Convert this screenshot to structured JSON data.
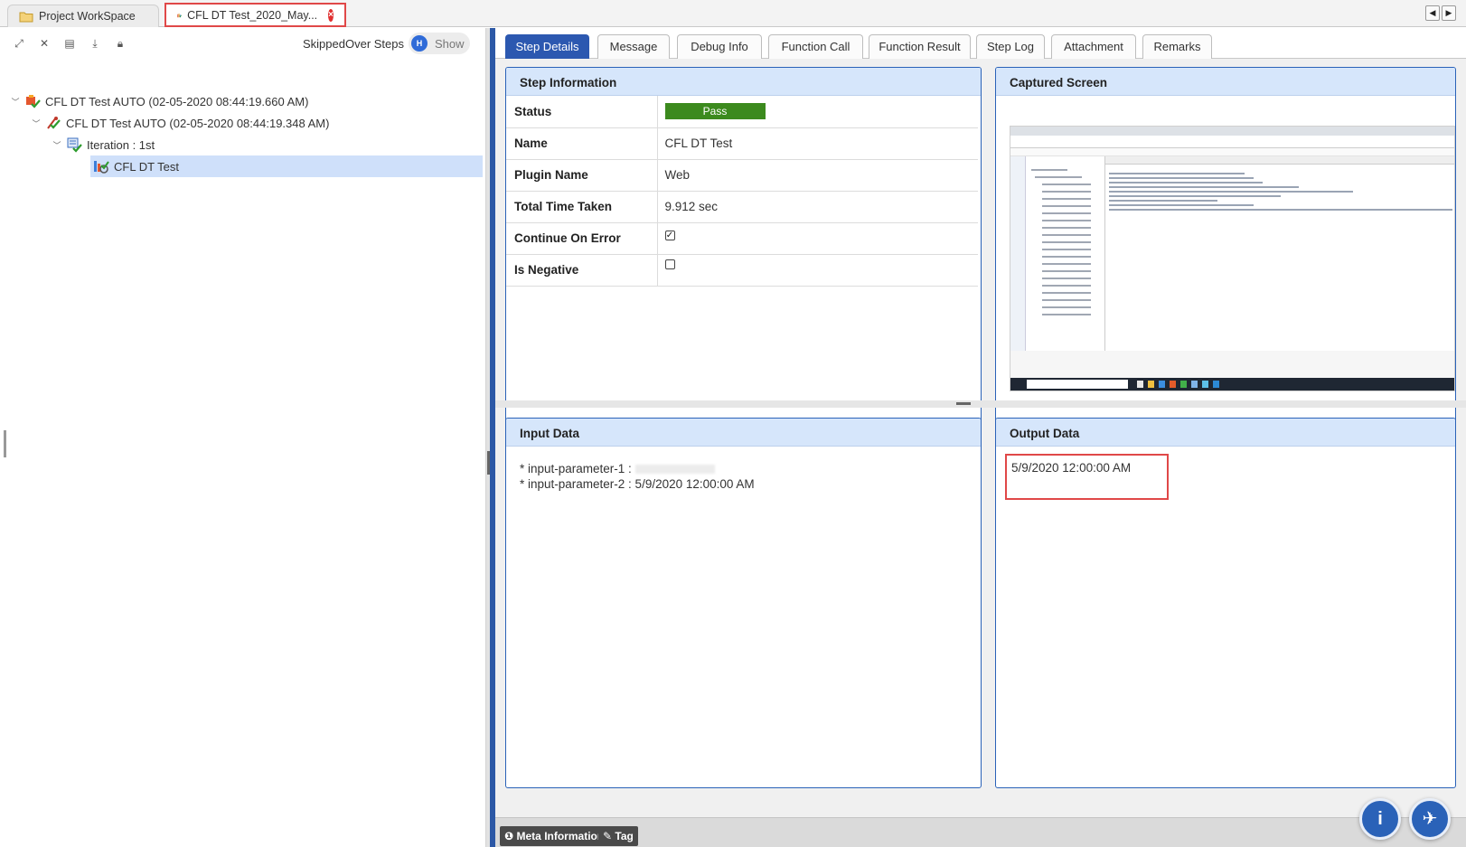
{
  "workspace_tabs": [
    {
      "label": "Project WorkSpace",
      "icon": "folder-icon"
    },
    {
      "label": "CFL DT Test_2020_May...",
      "icon": "test-report-icon",
      "active": true
    }
  ],
  "left_panel": {
    "toolbar_icons": [
      "expand-all-icon",
      "collapse-all-icon",
      "export-icon",
      "download-icon",
      "lock-icon"
    ],
    "skipped_label": "SkippedOver Steps",
    "show_label": "Show",
    "tree": [
      {
        "label": "CFL DT Test AUTO (02-05-2020 08:44:19.660 AM)",
        "level": 0,
        "icon": "suite-pass-icon"
      },
      {
        "label": "CFL DT Test AUTO (02-05-2020 08:44:19.348 AM)",
        "level": 1,
        "icon": "testcase-pass-icon"
      },
      {
        "label": "Iteration : 1st",
        "level": 2,
        "icon": "iteration-icon"
      },
      {
        "label": "CFL DT Test",
        "level": 3,
        "icon": "step-icon",
        "selected": true
      }
    ]
  },
  "detail_tabs": [
    "Step Details",
    "Message",
    "Debug Info",
    "Function Call",
    "Function Result",
    "Step Log",
    "Attachment",
    "Remarks"
  ],
  "active_tab": "Step Details",
  "step_info": {
    "title": "Step Information",
    "status_label": "Status",
    "status_value": "Pass",
    "name_label": "Name",
    "name_value": "CFL DT Test",
    "plugin_label": "Plugin Name",
    "plugin_value": "Web",
    "time_label": "Total Time Taken",
    "time_value": "9.912 sec",
    "continue_label": "Continue On Error",
    "continue_checked": true,
    "negative_label": "Is Negative",
    "negative_checked": false
  },
  "captured_screen": {
    "title": "Captured Screen"
  },
  "input_data": {
    "title": "Input Data",
    "line1_prefix": "* input-parameter-1 :",
    "line2": "* input-parameter-2 : 5/9/2020 12:00:00 AM"
  },
  "output_data": {
    "title": "Output Data",
    "value": "5/9/2020 12:00:00 AM"
  },
  "bottom_bar": {
    "meta_label": "Meta Information",
    "tag_label": "Tag"
  },
  "colors": {
    "accent_blue": "#2c58b0",
    "pass_green": "#3c8a1e",
    "highlight_red": "#e04848",
    "panel_header": "#d6e6fb"
  }
}
